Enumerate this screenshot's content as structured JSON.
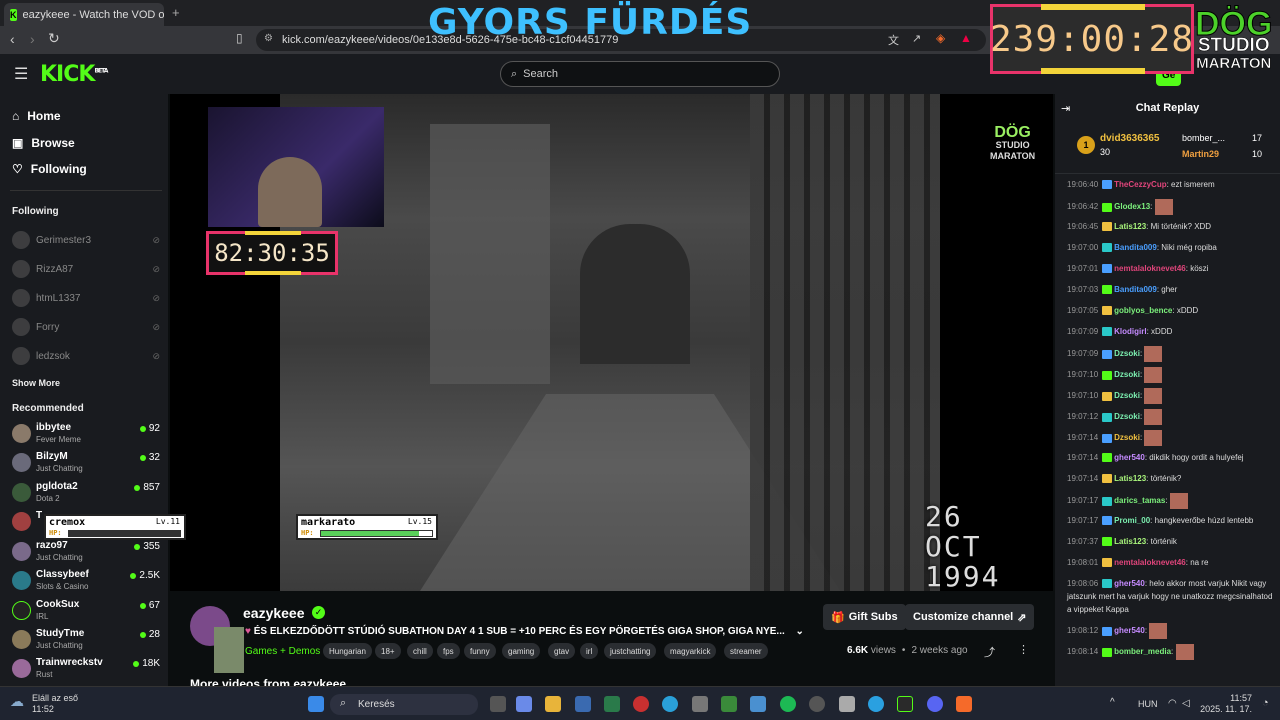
{
  "browser": {
    "tab_title": "eazykeee - Watch the VOD o",
    "url": "kick.com/eazykeee/videos/0e133e8d-5626-475e-bc48-c1cf04451779"
  },
  "header": {
    "logo": "KICK",
    "logo_badge": "BETA",
    "search_placeholder": "Search",
    "signin_label": "Ge"
  },
  "overlay": {
    "title": "GYORS FÜRDÉS",
    "big_timer": "239:00:28",
    "brand": [
      "DÖG",
      "STUDIO",
      "MARATON"
    ],
    "cam_timer": "82:30:35",
    "watermark": [
      "DÖG",
      "STUDIO",
      "MARATON"
    ],
    "date_stamp": [
      "26 OCT",
      "1994"
    ],
    "hp1": {
      "name": "cremox",
      "level": "Lv.11",
      "hp": 0.0
    },
    "hp2": {
      "name": "markarato",
      "level": "Lv.15",
      "hp": 0.88
    }
  },
  "sidebar": {
    "nav": [
      {
        "label": "Home",
        "icon": "home-icon"
      },
      {
        "label": "Browse",
        "icon": "browse-icon"
      },
      {
        "label": "Following",
        "icon": "heart-icon"
      }
    ],
    "following_title": "Following",
    "following": [
      "Gerimester3",
      "RizzA87",
      "htmL1337",
      "Forry",
      "ledzsok"
    ],
    "show_more": "Show More",
    "recommended_title": "Recommended",
    "recommended": [
      {
        "name": "ibbytee",
        "category": "Fever Meme",
        "viewers": "92"
      },
      {
        "name": "BilzyM",
        "category": "Just Chatting",
        "viewers": "32"
      },
      {
        "name": "pgldota2",
        "category": "Dota 2",
        "viewers": "857"
      },
      {
        "name": "T",
        "category": "",
        "viewers": ""
      },
      {
        "name": "razo97",
        "category": "Just Chatting",
        "viewers": "355"
      },
      {
        "name": "Classybeef",
        "category": "Slots & Casino",
        "viewers": "2.5K"
      },
      {
        "name": "CookSux",
        "category": "IRL",
        "viewers": "67"
      },
      {
        "name": "StudyTme",
        "category": "Just Chatting",
        "viewers": "28"
      },
      {
        "name": "Trainwreckstv",
        "category": "Rust",
        "viewers": "18K"
      }
    ]
  },
  "video_info": {
    "channel": "eazykeee",
    "title": "ÉS ELKEZDŐDÖTT STÚDIÓ SUBATHON DAY 4 1 SUB = +10 PERC ÉS EGY PÖRGETÉS GIGA SHOP, GIGA NYE...",
    "category": "Games + Demos",
    "tags": [
      "Hungarian",
      "18+",
      "chill",
      "fps",
      "funny",
      "gaming",
      "gtav",
      "irl",
      "justchatting",
      "magyarkick",
      "streamer"
    ],
    "views": "6.6K",
    "views_label": "views",
    "age": "2 weeks ago",
    "gift_subs": "Gift Subs",
    "customize": "Customize channel",
    "more_videos": "More videos from eazykeee"
  },
  "chat": {
    "title": "Chat Replay",
    "leaders": [
      {
        "rank": "1",
        "name": "dvid3636365",
        "count": "30"
      },
      {
        "name": "bomber_...",
        "count": "17"
      },
      {
        "name": "Martin29",
        "count": "10"
      }
    ],
    "messages": [
      {
        "time": "19:06:40",
        "user": "TheCezzyCup",
        "color": "#e0457b",
        "text": "ezt ismerem",
        "emote": false
      },
      {
        "time": "19:06:42",
        "user": "Glodex13",
        "color": "#7cf07c",
        "text": "",
        "emote": true
      },
      {
        "time": "19:06:45",
        "user": "Latis123",
        "color": "#a9f57c",
        "text": "Mi történik? XDD",
        "emote": false
      },
      {
        "time": "19:07:00",
        "user": "Bandita009",
        "color": "#4a9fff",
        "text": "Niki még ropiba",
        "emote": false
      },
      {
        "time": "19:07:01",
        "user": "nemtalaloknevet46",
        "color": "#e0457b",
        "text": "köszi",
        "emote": false
      },
      {
        "time": "19:07:03",
        "user": "Bandita009",
        "color": "#4a9fff",
        "text": "gher",
        "emote": false
      },
      {
        "time": "19:07:05",
        "user": "goblyos_bence",
        "color": "#7cf07c",
        "text": "xDDD",
        "emote": false
      },
      {
        "time": "19:07:09",
        "user": "Klodigirl",
        "color": "#c58bff",
        "text": "xDDD",
        "emote": false
      },
      {
        "time": "19:07:09",
        "user": "Dzsoki",
        "color": "#7cf0b0",
        "text": "",
        "emote": true
      },
      {
        "time": "19:07:10",
        "user": "Dzsoki",
        "color": "#7cf0b0",
        "text": "",
        "emote": true
      },
      {
        "time": "19:07:10",
        "user": "Dzsoki",
        "color": "#7cf0b0",
        "text": "",
        "emote": true
      },
      {
        "time": "19:07:12",
        "user": "Dzsoki",
        "color": "#7cf0b0",
        "text": "",
        "emote": true
      },
      {
        "time": "19:07:14",
        "user": "Dzsoki",
        "color": "#f0c040",
        "text": "",
        "emote": true
      },
      {
        "time": "19:07:14",
        "user": "gher540",
        "color": "#c58bff",
        "text": "dikdik hogy ordit a hulyefej",
        "emote": false
      },
      {
        "time": "19:07:14",
        "user": "Latis123",
        "color": "#a9f57c",
        "text": "történik?",
        "emote": false
      },
      {
        "time": "19:07:17",
        "user": "darics_tamas",
        "color": "#7cf07c",
        "text": "",
        "emote": true
      },
      {
        "time": "19:07:17",
        "user": "Promi_00",
        "color": "#7cf0b0",
        "text": "hangkeverőbe húzd lentebb",
        "emote": false
      },
      {
        "time": "19:07:37",
        "user": "Latis123",
        "color": "#a9f57c",
        "text": "történik",
        "emote": false
      },
      {
        "time": "19:08:01",
        "user": "nemtalaloknevet46",
        "color": "#e0457b",
        "text": "na re",
        "emote": false
      },
      {
        "time": "19:08:06",
        "user": "gher540",
        "color": "#c58bff",
        "text": "helo akkor most varjuk Nikit vagy jatszunk mert ha varjuk hogy ne unatkozz megcsinalhatod a vippeket Kappa",
        "emote": false
      },
      {
        "time": "19:08:12",
        "user": "gher540",
        "color": "#c58bff",
        "text": "",
        "emote": true
      },
      {
        "time": "19:08:14",
        "user": "bomber_media",
        "color": "#7cf07c",
        "text": "",
        "emote": true
      }
    ]
  },
  "taskbar": {
    "weather_line1": "Eláll az eső",
    "weather_line2": "11:52",
    "search": "Keresés",
    "lang": "HUN",
    "time": "11:57",
    "date": "2025. 11. 17."
  }
}
